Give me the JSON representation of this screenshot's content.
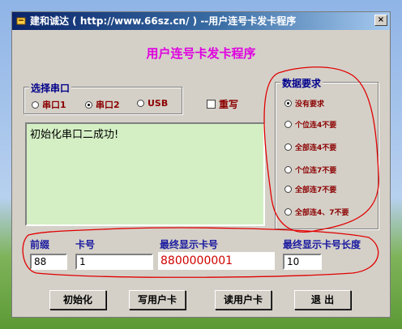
{
  "window": {
    "title": "建和诚达 ( http://www.66sz.cn/ ) --用户连号卡发卡程序",
    "close_label": "×"
  },
  "program_title": "用户连号卡发卡程序",
  "serial_group": {
    "legend": "选择串口",
    "options": [
      {
        "label": "串口1",
        "selected": false
      },
      {
        "label": "串口2",
        "selected": true
      },
      {
        "label": "USB",
        "selected": false
      }
    ],
    "rewrite_label": "重写",
    "rewrite_checked": false
  },
  "output": {
    "text": "初始化串口二成功!"
  },
  "data_group": {
    "legend": "数据要求",
    "options": [
      {
        "label": "没有要求",
        "selected": true
      },
      {
        "label": "个位连4不要",
        "selected": false
      },
      {
        "label": "全部连4不要",
        "selected": false
      },
      {
        "label": "个位连7不要",
        "selected": false
      },
      {
        "label": "全部连7不要",
        "selected": false
      },
      {
        "label": "全部连4、7不要",
        "selected": false
      }
    ]
  },
  "fields": {
    "prefix_label": "前缀",
    "prefix_value": "88",
    "card_label": "卡号",
    "card_value": "1",
    "final_card_label": "最终显示卡号",
    "final_card_value": "8800000001",
    "final_len_label": "最终显示卡号长度",
    "final_len_value": "10"
  },
  "buttons": {
    "init": "初始化",
    "write": "写用户卡",
    "read": "读用户卡",
    "exit": "退  出"
  },
  "colors": {
    "title_magenta": "#e000e0",
    "annotation_red": "#e00000",
    "output_bg": "#d4efc4"
  }
}
